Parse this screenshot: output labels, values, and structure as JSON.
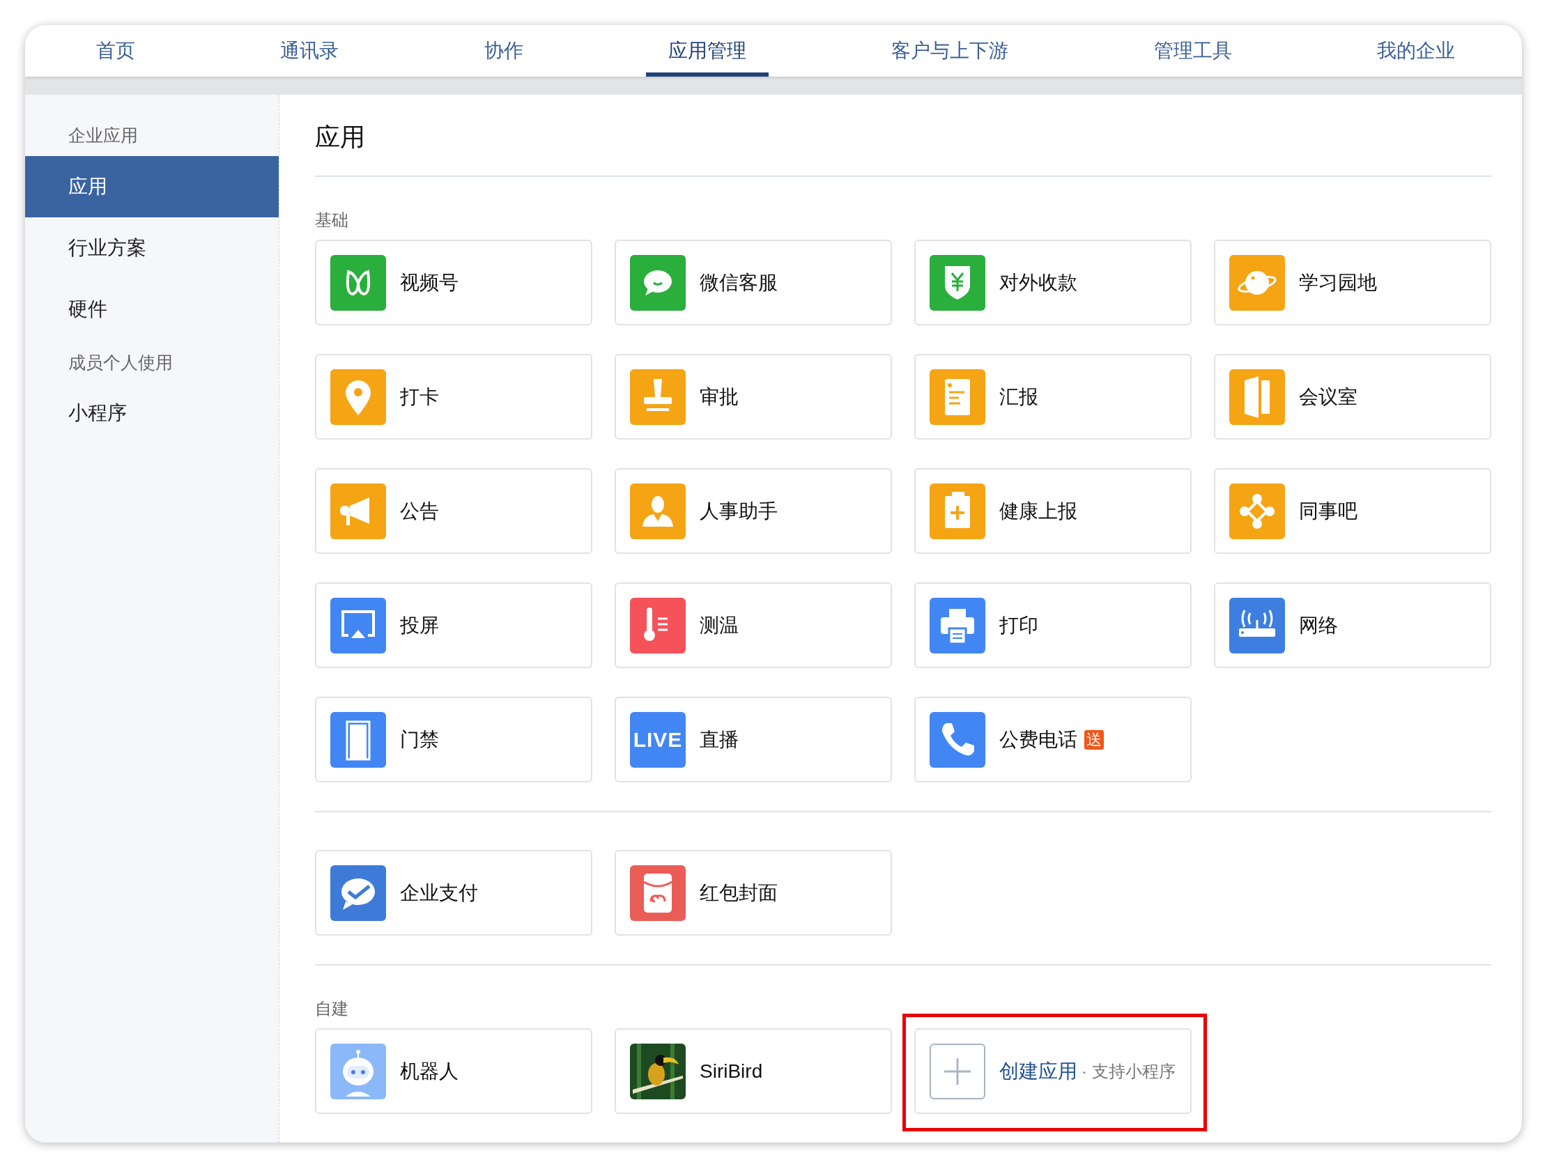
{
  "tabs": [
    {
      "label": "首页",
      "selected": false
    },
    {
      "label": "通讯录",
      "selected": false
    },
    {
      "label": "协作",
      "selected": false
    },
    {
      "label": "应用管理",
      "selected": true
    },
    {
      "label": "客户与上下游",
      "selected": false
    },
    {
      "label": "管理工具",
      "selected": false
    },
    {
      "label": "我的企业",
      "selected": false
    }
  ],
  "sidebar": {
    "items": [
      {
        "kind": "header",
        "label": "企业应用"
      },
      {
        "kind": "item",
        "label": "应用",
        "selected": true
      },
      {
        "kind": "item",
        "label": "行业方案",
        "selected": false
      },
      {
        "kind": "item",
        "label": "硬件",
        "selected": false
      },
      {
        "kind": "header",
        "label": "成员个人使用"
      },
      {
        "kind": "item",
        "label": "小程序",
        "selected": false
      }
    ]
  },
  "content": {
    "title": "应用",
    "sections": [
      {
        "label": "基础",
        "apps": [
          {
            "name": "视频号",
            "color": "#2aae3c"
          },
          {
            "name": "微信客服",
            "color": "#2aae3c"
          },
          {
            "name": "对外收款",
            "color": "#2aae3c"
          },
          {
            "name": "学习园地",
            "color": "#f5a414"
          },
          {
            "name": "打卡",
            "color": "#f5a414"
          },
          {
            "name": "审批",
            "color": "#f5a414"
          },
          {
            "name": "汇报",
            "color": "#f5a414"
          },
          {
            "name": "会议室",
            "color": "#f5a414"
          },
          {
            "name": "公告",
            "color": "#f5a414"
          },
          {
            "name": "人事助手",
            "color": "#f5a414"
          },
          {
            "name": "健康上报",
            "color": "#f5a414"
          },
          {
            "name": "同事吧",
            "color": "#f5a414"
          },
          {
            "name": "投屏",
            "color": "#4286f4"
          },
          {
            "name": "测温",
            "color": "#f5525a"
          },
          {
            "name": "打印",
            "color": "#4286f4"
          },
          {
            "name": "网络",
            "color": "#3c7fe0"
          },
          {
            "name": "门禁",
            "color": "#4286f4"
          },
          {
            "name": "直播",
            "color": "#4286f4",
            "icon_label": "LIVE"
          },
          {
            "name": "公费电话",
            "color": "#4286f4",
            "badge": "送"
          }
        ]
      },
      {
        "apps": [
          {
            "name": "企业支付",
            "color": "#3e7bd8"
          },
          {
            "name": "红包封面",
            "color": "#ea5d57"
          }
        ]
      },
      {
        "label": "自建",
        "apps": [
          {
            "name": "机器人",
            "color": "#8ab8f8"
          },
          {
            "name": "SiriBird",
            "color": "#1e4a22"
          }
        ],
        "create": {
          "label": "创建应用",
          "hint": "· 支持小程序",
          "highlighted": true
        }
      }
    ]
  }
}
